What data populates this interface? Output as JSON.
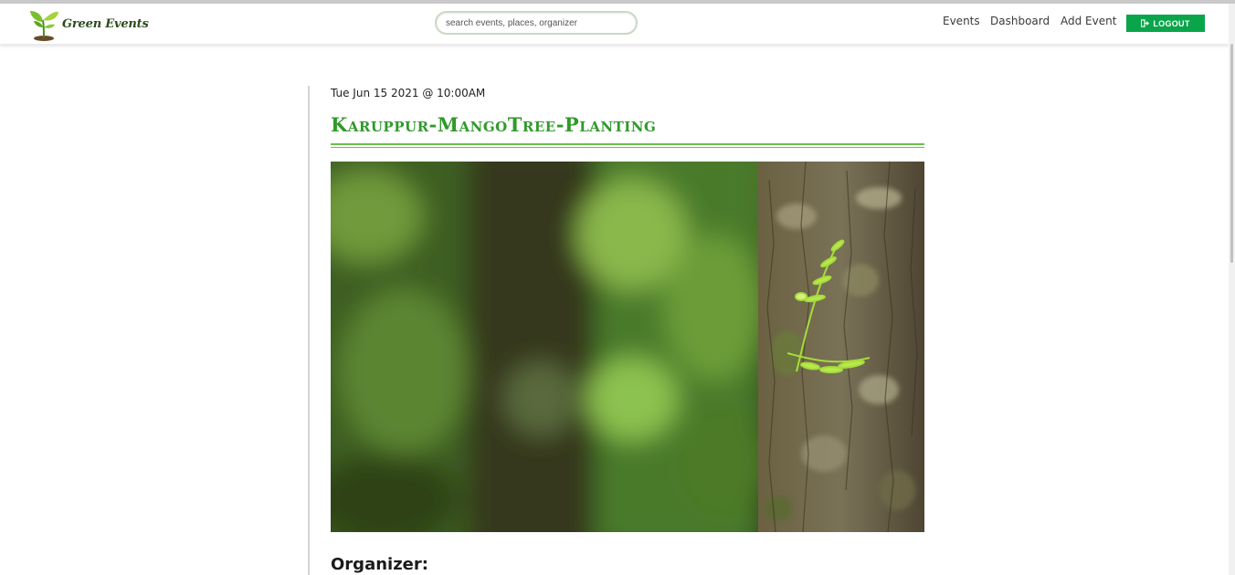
{
  "brand": {
    "name": "Green Events",
    "logo_icon": "sprout-icon"
  },
  "search": {
    "placeholder": "search events, places, organizer",
    "value": ""
  },
  "nav": {
    "events": "Events",
    "dashboard": "Dashboard",
    "add_event": "Add Event",
    "logout": "LOGOUT",
    "logout_icon": "sign-out-icon"
  },
  "event": {
    "date": "Tue Jun 15 2021 @ 10:00AM",
    "title": "Karuppur-MangoTree-Planting",
    "image_subject": "seedling sprouting from tree bark",
    "organizer_label": "Organizer:"
  },
  "colors": {
    "accent": "#2f9a2a",
    "button": "#0aa54a",
    "rule": "#6cbf49"
  }
}
